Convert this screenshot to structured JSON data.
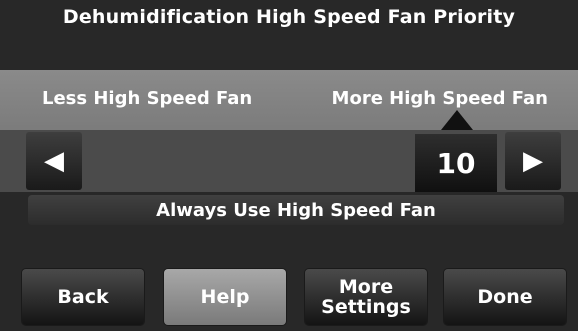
{
  "screen": {
    "title": "Dehumidification High Speed Fan Priority"
  },
  "slider": {
    "left_label": "Less High Speed Fan",
    "right_label": "More High Speed Fan",
    "value": "10",
    "decrease_icon": "◀",
    "increase_icon": "▶"
  },
  "option": {
    "always_label": "Always Use High Speed Fan"
  },
  "buttons": {
    "back": "Back",
    "help": "Help",
    "more_line1": "More",
    "more_line2": "Settings",
    "done": "Done"
  },
  "colors": {
    "background": "#282828",
    "panel": "#7f7f7f",
    "help_button": "#9a9a9a",
    "text": "#ffffff"
  }
}
